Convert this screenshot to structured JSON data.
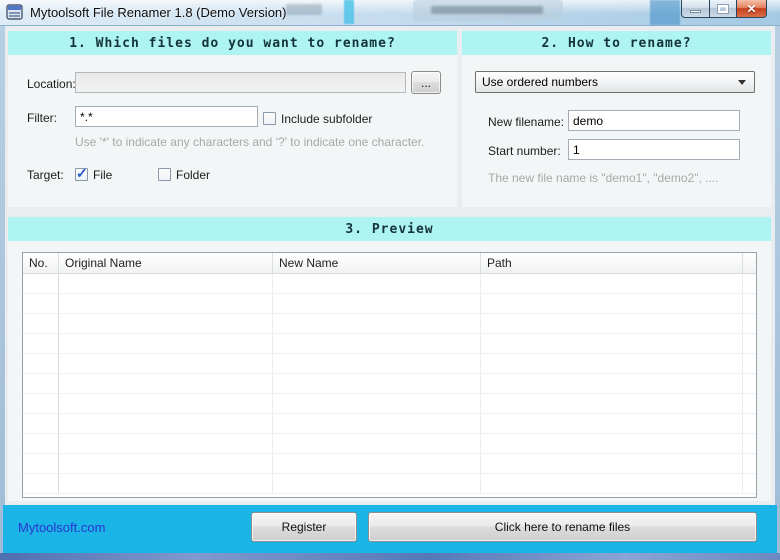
{
  "window": {
    "title": "Mytoolsoft File Renamer 1.8 (Demo Version)"
  },
  "section1": {
    "heading": "1. Which files do you want to rename?",
    "location_label": "Location:",
    "location_value": "",
    "browse_label": "...",
    "filter_label": "Filter:",
    "filter_value": "*.*",
    "include_subfolder_label": "Include subfolder",
    "include_subfolder_checked": false,
    "filter_hint": "Use '*' to indicate any characters and '?' to indicate one character.",
    "target_label": "Target:",
    "file_label": "File",
    "file_checked": true,
    "folder_label": "Folder",
    "folder_checked": false
  },
  "section2": {
    "heading": "2. How to rename?",
    "method_selected": "Use ordered numbers",
    "new_filename_label": "New filename:",
    "new_filename_value": "demo",
    "start_number_label": "Start number:",
    "start_number_value": "1",
    "hint": "The new file name is \"demo1\", \"demo2\", ...."
  },
  "section3": {
    "heading": "3. Preview",
    "columns": [
      "No.",
      "Original Name",
      "New Name",
      "Path"
    ],
    "rows": []
  },
  "footer": {
    "link": "Mytoolsoft.com",
    "register_label": "Register",
    "rename_label": "Click here to rename files"
  },
  "colors": {
    "band": "#adf4f3",
    "footer_bar": "#1bb4e7",
    "link": "#2a35cf"
  }
}
